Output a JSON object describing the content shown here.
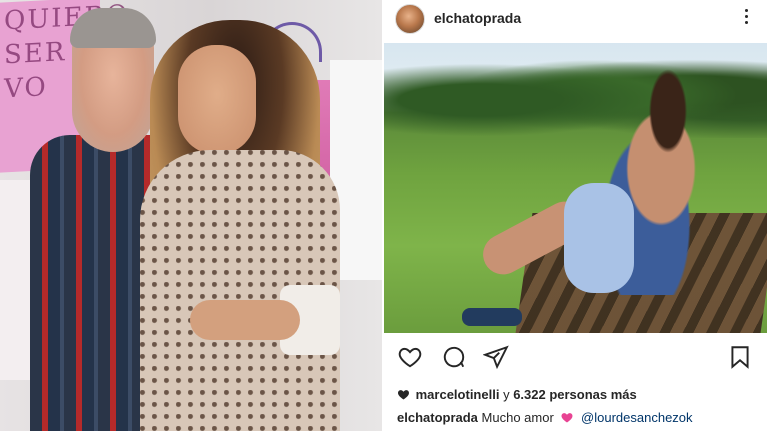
{
  "left_photo": {
    "poster_text": "QUIERO SER VO",
    "alt": "Photo of a couple posing"
  },
  "post": {
    "username": "elchatoprada",
    "likes": {
      "first_user": "marcelotinelli",
      "connector": "y",
      "count_text": "6.322 personas más"
    },
    "caption": {
      "author": "elchatoprada",
      "text": "Mucho amor",
      "mention": "@lourdesanchezok"
    }
  },
  "colors": {
    "text": "#262626",
    "mention": "#003569",
    "heart_pink": "#e84393"
  },
  "icons": {
    "more": "vertical-dots-icon",
    "like": "heart-outline-icon",
    "comment": "comment-bubble-icon",
    "share": "paper-plane-icon",
    "save": "bookmark-icon"
  }
}
